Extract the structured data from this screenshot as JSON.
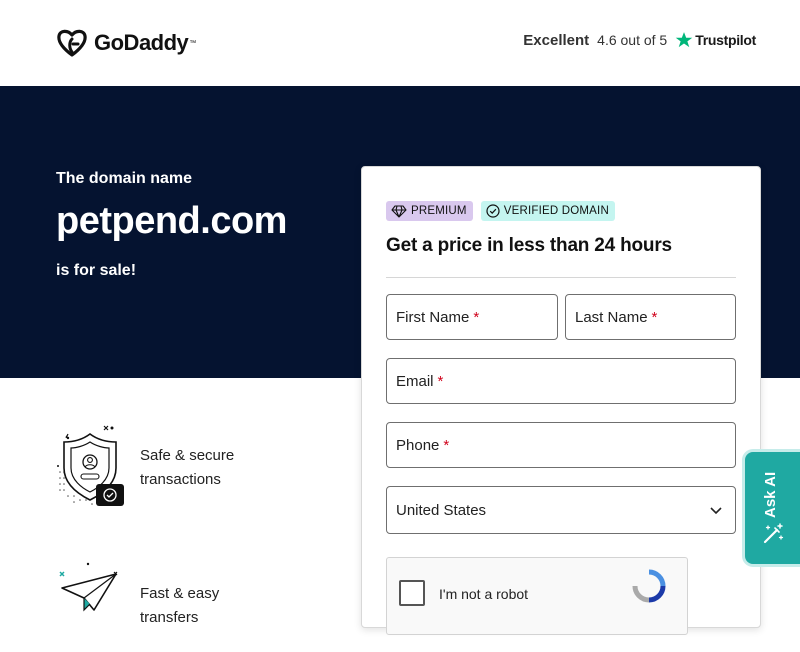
{
  "header": {
    "logo_text": "GoDaddy",
    "logo_tm": "™",
    "rating_label": "Excellent",
    "rating_score": "4.6 out of 5",
    "rating_provider": "Trustpilot"
  },
  "hero": {
    "pre_text": "The domain name",
    "domain": "petpend.com",
    "post_text": "is for sale!"
  },
  "features": [
    {
      "text": "Safe & secure transactions",
      "icon": "shield-check-icon"
    },
    {
      "text": "Fast & easy transfers",
      "icon": "paper-plane-icon"
    }
  ],
  "card": {
    "badge_premium": "PREMIUM",
    "badge_verified": "VERIFIED DOMAIN",
    "title": "Get a price in less than 24 hours",
    "first_name_label": "First Name",
    "last_name_label": "Last Name",
    "email_label": "Email",
    "phone_label": "Phone",
    "required_mark": "*",
    "country_value": "United States",
    "captcha_text": "I'm not a robot"
  },
  "ask_ai": {
    "label": "Ask AI"
  },
  "colors": {
    "hero_bg": "#051330",
    "accent_teal": "#1fa9a2",
    "premium_badge": "#d9c8ee",
    "verified_badge": "#c4f5f0",
    "trustpilot_star": "#00b67a",
    "required": "#d0021b"
  }
}
